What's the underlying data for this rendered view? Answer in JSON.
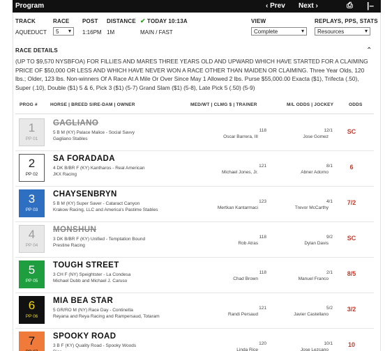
{
  "toolbar": {
    "title": "Program",
    "prev_label": "‹ Prev",
    "next_label": "Next ›",
    "print_icon": "print-icon",
    "minimize_icon": "minus-icon"
  },
  "race_info": {
    "track_label": "TRACK",
    "track_value": "AQUEDUCT",
    "race_label": "RACE",
    "race_value": "5",
    "post_label": "POST",
    "post_value": "1:16PM",
    "distance_label": "DISTANCE",
    "distance_value": "1M",
    "today_label": "TODAY 10:13A",
    "surface_value": "MAIN / FAST",
    "view_label": "VIEW",
    "view_value": "Complete",
    "replays_label": "REPLAYS, PPS, STATS",
    "replays_value": "Resources"
  },
  "race_details": {
    "heading": "RACE DETAILS",
    "text": "(UP TO $9,570 NYSBFOA) FOR FILLIES AND MARES THREE YEARS OLD AND UPWARD WHICH HAVE STARTED FOR A CLAIMING PRICE OF $50,000 OR LESS AND WHICH HAVE NEVER WON A RACE OTHER THAN MAIDEN OR CLAIMING. Three Year Olds, 120 lbs.; Older, 123 lbs. Non-winners Of A Race At A Mile Or Over Since May 1 Allowed 2 lbs. Purse $55,000.00 Exacta ($1), Trifecta (.50), Super (.10), Double ($1) 5 & 6, Pick 3 ($1) (5-7) Grand Slam ($1) (5-8), Late Pick 5 (.50) (5-9)"
  },
  "columns": {
    "prog": "PROG #",
    "horse": "HORSE | BREED SIRE-DAM | OWNER",
    "med": "MED/WT | CLMG $ | TRAINER",
    "ml": "M/L ODDS | JOCKEY",
    "odds": "ODDS"
  },
  "entries": [
    {
      "num": "1",
      "pp": "PP 01",
      "name": "GAGLIANO",
      "breed": "5 B M (KY) Palace Malice - Social Savvy",
      "owner": "Gagliano Stables",
      "wt": "118",
      "trainer": "Oscar Barrera, III",
      "ml": "12/1",
      "jockey": "Jose Gomez",
      "odds": "SC",
      "scratched": true,
      "bg": "#e8e8e8",
      "fg": "#999999",
      "border": "#cfcfcf"
    },
    {
      "num": "2",
      "pp": "PP 02",
      "name": "SA FORADADA",
      "breed": "4 DK B/BR F (KY) Kantharos - Real American",
      "owner": "JKX Racing",
      "wt": "121",
      "trainer": "Michael Jones, Jr.",
      "ml": "8/1",
      "jockey": "Abner Adorno",
      "odds": "6",
      "scratched": false,
      "bg": "#ffffff",
      "fg": "#222222",
      "border": "#555555"
    },
    {
      "num": "3",
      "pp": "PP 03",
      "name": "CHAYSENBRYN",
      "breed": "5 B M (KY) Super Saver - Cataract Canyon",
      "owner": "Krakow Racing, LLC and America's Pastime Stables",
      "wt": "123",
      "trainer": "Mertkan Kantarmaci",
      "ml": "4/1",
      "jockey": "Trevor McCarthy",
      "odds": "7/2",
      "scratched": false,
      "bg": "#2f6fc2",
      "fg": "#ffffff",
      "border": "#2f6fc2"
    },
    {
      "num": "4",
      "pp": "PP 04",
      "name": "MONSHUN",
      "breed": "3 DK B/BR F (KY) Unified - Temptation Bound",
      "owner": "Prestine Racing",
      "wt": "118",
      "trainer": "Rob Atras",
      "ml": "9/2",
      "jockey": "Dylan Davis",
      "odds": "SC",
      "scratched": true,
      "bg": "#e8e8e8",
      "fg": "#999999",
      "border": "#cfcfcf"
    },
    {
      "num": "5",
      "pp": "PP 05",
      "name": "TOUGH STREET",
      "breed": "3 CH F (NY) Speightster - La Condesa",
      "owner": "Michael Dubb and Michael J. Caruso",
      "wt": "118",
      "trainer": "Chad Brown",
      "ml": "2/1",
      "jockey": "Manuel Franco",
      "odds": "8/5",
      "scratched": false,
      "bg": "#1e9e3e",
      "fg": "#ffffff",
      "border": "#1e9e3e"
    },
    {
      "num": "6",
      "pp": "PP 06",
      "name": "MIA BEA STAR",
      "breed": "5 GR/RO M (NY) Race Day - Continetta",
      "owner": "Reyana and Reya Racing and Rampersaud, Totaram",
      "wt": "121",
      "trainer": "Randi Persaud",
      "ml": "5/2",
      "jockey": "Javier Castellano",
      "odds": "3/2",
      "scratched": false,
      "bg": "#111111",
      "fg": "#f5d90a",
      "border": "#111111"
    },
    {
      "num": "7",
      "pp": "PP 07",
      "name": "SPOOKY ROAD",
      "breed": "3 B F (KY) Quality Road - Spooky Woods",
      "owner": "Rice",
      "wt": "120",
      "trainer": "Linda Rice",
      "ml": "10/1",
      "jockey": "Jose Lezcano",
      "odds": "10",
      "scratched": false,
      "bg": "#f07a3a",
      "fg": "#111111",
      "border": "#f07a3a"
    }
  ]
}
